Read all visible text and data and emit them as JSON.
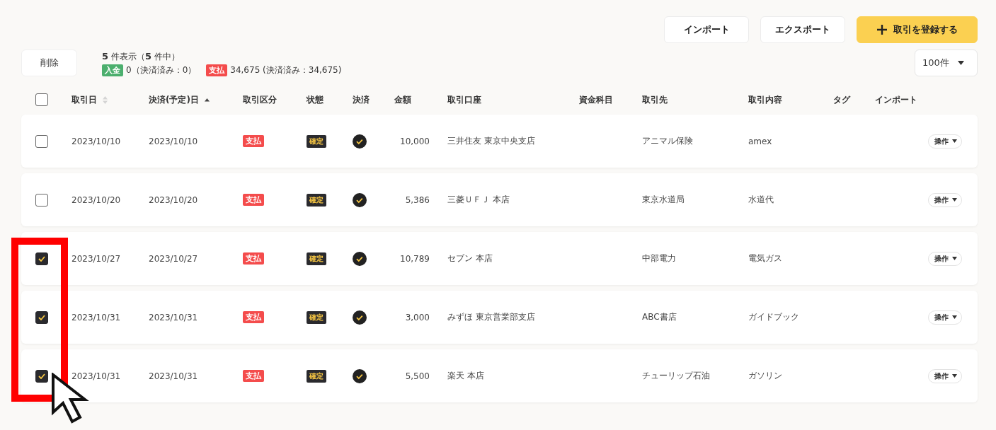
{
  "toolbar": {
    "buttons": [
      {
        "label": "インポート",
        "kind": "plain"
      },
      {
        "label": "エクスポート",
        "kind": "plain"
      },
      {
        "label": "取引を登録する",
        "kind": "primary"
      }
    ]
  },
  "delete_button": "削除",
  "summary": {
    "count": "**5** 件表示（**5** 件中）",
    "totals": [
      {
        "badge": "入金",
        "color": "#4caf6e",
        "text": "0（決済済み：0）"
      },
      {
        "badge": "支払",
        "color": "#f44c4c",
        "text": "34,675 (決済済み：34,675)"
      }
    ]
  },
  "per_page": "100件",
  "table": {
    "select_all": {
      "checked": false
    },
    "columns": [
      {
        "label": "取引日",
        "sortable": true,
        "sorted": false
      },
      {
        "label": "決済(予定)日",
        "sortable": true,
        "sorted": true
      },
      {
        "label": "取引区分"
      },
      {
        "label": "状態"
      },
      {
        "label": "決済"
      },
      {
        "label": "金額"
      },
      {
        "label": "取引口座"
      },
      {
        "label": "資金科目"
      },
      {
        "label": "取引先"
      },
      {
        "label": "取引内容"
      },
      {
        "label": "タグ"
      },
      {
        "label": "インポート"
      }
    ],
    "rows": [
      {
        "checked": false,
        "date": "2023/10/10",
        "settle_date": "2023/10/10",
        "type": "支払",
        "kind": "expense",
        "status": "確定",
        "settled": true,
        "amount": "10,000",
        "account": "三井住友 東京中央支店",
        "partner": "アニマル保険",
        "content": "amex",
        "action": "操作"
      },
      {
        "checked": false,
        "date": "2023/10/20",
        "settle_date": "2023/10/20",
        "type": "支払",
        "kind": "expense",
        "status": "確定",
        "settled": true,
        "amount": "5,386",
        "account": "三菱ＵＦＪ 本店",
        "partner": "東京水道局",
        "content": "水道代",
        "action": "操作"
      },
      {
        "checked": true,
        "date": "2023/10/27",
        "settle_date": "2023/10/27",
        "type": "支払",
        "kind": "expense",
        "status": "確定",
        "settled": true,
        "amount": "10,789",
        "account": "セブン 本店",
        "partner": "中部電力",
        "content": "電気ガス",
        "action": "操作"
      },
      {
        "checked": true,
        "date": "2023/10/31",
        "settle_date": "2023/10/31",
        "type": "支払",
        "kind": "expense",
        "status": "確定",
        "settled": true,
        "amount": "3,000",
        "account": "みずほ 東京営業部支店",
        "partner": "ABC書店",
        "content": "ガイドブック",
        "action": "操作"
      },
      {
        "checked": true,
        "date": "2023/10/31",
        "settle_date": "2023/10/31",
        "type": "支払",
        "kind": "expense",
        "status": "確定",
        "settled": true,
        "amount": "5,500",
        "account": "楽天 本店",
        "partner": "チューリップ石油",
        "content": "ガソリン",
        "action": "操作"
      }
    ]
  },
  "annotations": [
    {
      "kind": "highlight-box"
    },
    {
      "kind": "cursor"
    }
  ]
}
